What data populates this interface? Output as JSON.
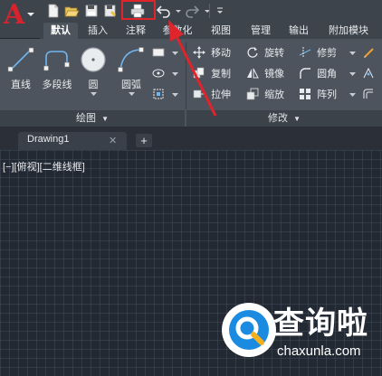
{
  "app": {
    "logo_letter": "A"
  },
  "quick_access": {
    "icons": [
      "new-icon",
      "open-icon",
      "save-icon",
      "save-as-icon",
      "print-icon",
      "undo-icon",
      "redo-icon",
      "customize-icon"
    ]
  },
  "tabs": [
    {
      "label": "默认",
      "active": true
    },
    {
      "label": "插入"
    },
    {
      "label": "注释"
    },
    {
      "label": "参数化"
    },
    {
      "label": "视图"
    },
    {
      "label": "管理"
    },
    {
      "label": "输出"
    },
    {
      "label": "附加模块"
    }
  ],
  "draw_panel": {
    "title": "绘图",
    "tools": [
      {
        "label": "直线",
        "icon": "line-icon"
      },
      {
        "label": "多段线",
        "icon": "polyline-icon"
      },
      {
        "label": "圆",
        "icon": "circle-icon"
      },
      {
        "label": "圆弧",
        "icon": "arc-icon"
      }
    ]
  },
  "modify_panel": {
    "title": "修改",
    "tools": [
      {
        "label": "移动",
        "icon": "move-icon"
      },
      {
        "label": "旋转",
        "icon": "rotate-icon"
      },
      {
        "label": "修剪",
        "icon": "trim-icon"
      },
      {
        "label": "复制",
        "icon": "copy-icon"
      },
      {
        "label": "镜像",
        "icon": "mirror-icon"
      },
      {
        "label": "圆角",
        "icon": "fillet-icon"
      },
      {
        "label": "拉伸",
        "icon": "stretch-icon"
      },
      {
        "label": "缩放",
        "icon": "scale-icon"
      },
      {
        "label": "阵列",
        "icon": "array-icon"
      }
    ]
  },
  "document": {
    "tab_name": "Drawing1",
    "close_glyph": "✕",
    "new_tab_glyph": "+"
  },
  "viewport": {
    "label": "[−][俯视][二维线框]"
  },
  "watermark": {
    "text": "查询啦",
    "url": "chaxunla.com"
  },
  "colors": {
    "accent_red": "#e0242b",
    "logo_red": "#d6232d",
    "ribbon_bg": "#4d545d",
    "canvas_bg": "#222932"
  }
}
